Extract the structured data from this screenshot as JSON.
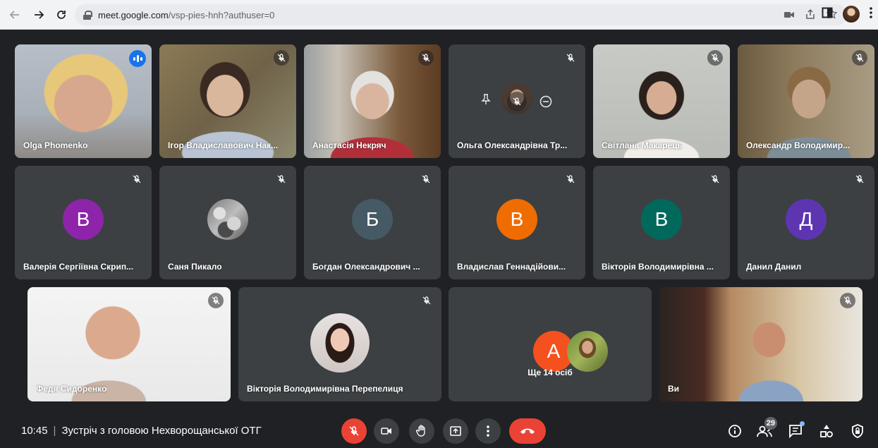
{
  "browser": {
    "url_host": "meet.google.com",
    "url_path": "/vsp-pies-hnh?authuser=0",
    "icons": [
      "back-arrow",
      "forward-arrow",
      "reload",
      "lock",
      "camera",
      "share",
      "star",
      "side-panel",
      "profile",
      "menu-dots"
    ]
  },
  "participants": {
    "row1": [
      {
        "name": "Olga Phomenko",
        "speaking": true
      },
      {
        "name": "Ігор Владиславович Нак..."
      },
      {
        "name": "Анастасія Некряч"
      },
      {
        "name": "Ольга Олександрівна Тр..."
      },
      {
        "name": "Світлана Макарець"
      },
      {
        "name": "Олександр Володимир..."
      }
    ],
    "row2": [
      {
        "name": "Валерія Сергіївна Скрип...",
        "initial": "В",
        "color": "#8e24aa"
      },
      {
        "name": "Саня Пикало",
        "initial": ""
      },
      {
        "name": "Богдан Олександрович ...",
        "initial": "Б",
        "color": "#455a64"
      },
      {
        "name": "Владислав Геннадійови...",
        "initial": "В",
        "color": "#ef6c00"
      },
      {
        "name": "Вікторія Володимирівна ...",
        "initial": "В",
        "color": "#00695c"
      },
      {
        "name": "Данил Данил",
        "initial": "Д",
        "color": "#5e35b1"
      }
    ],
    "row3": [
      {
        "name": "Федя Сидоренко"
      },
      {
        "name": "Вікторія Володимирівна Перепелиця"
      },
      {
        "name": "Ще 14 осіб",
        "initial": "А",
        "color": "#f4511e"
      },
      {
        "name": "Ви"
      }
    ]
  },
  "bottom_bar": {
    "time": "10:45",
    "separator": "|",
    "meeting_title": "Зустріч з головою Нехворощанської ОТГ",
    "participant_count": "29",
    "colors": {
      "end_call": "#ea4335",
      "mic_off": "#ea4335"
    }
  }
}
